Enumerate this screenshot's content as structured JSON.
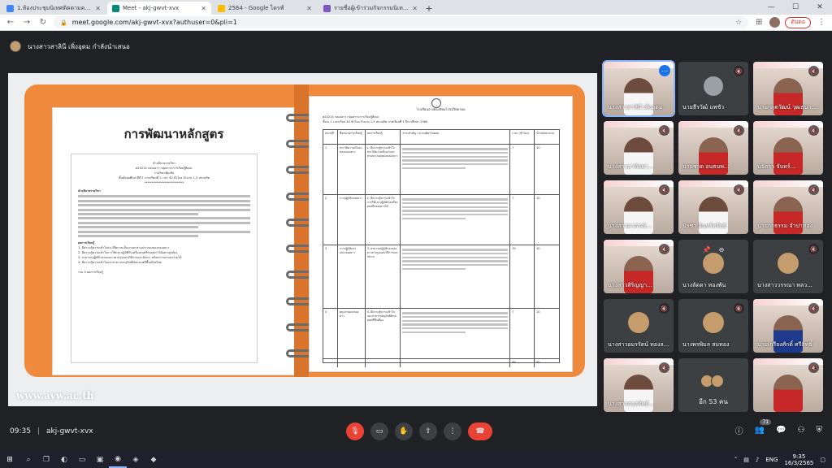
{
  "browser": {
    "tabs": [
      {
        "title": "1.ห้องประชุมนิเทศติดตามครูออนไลน์ (กลุ่มสาระ...",
        "color": "#4285f4",
        "active": false
      },
      {
        "title": "Meet - akj-gwvt-xvx",
        "color": "#00897b",
        "active": true
      },
      {
        "title": "2564 - Google ไดรฟ์",
        "color": "#fbbc04",
        "active": false
      },
      {
        "title": "รายชื่อผู้เข้าร่วมกิจกรรมนิเทศติดตามการจัดการเรียนรู้...",
        "color": "#7e57c2",
        "active": false
      }
    ],
    "new_tab": "+",
    "url": "meet.google.com/akj-gwvt-xvx?authuser=0&pli=1",
    "pause_label": "ดับตอ",
    "window_controls": {
      "minimize": "—",
      "maximize": "☐",
      "close": "✕"
    }
  },
  "meet": {
    "presenter_label": "นางสาวสาลินี เพิ่งอุดม กำลังนำเสนอ",
    "slide": {
      "title": "การพัฒนาหลักสูตร",
      "watermark": "www.ayw.ac.th",
      "left_doc": {
        "heading": "คำอธิบายรายวิชา",
        "code_line": "ศ20214  กลองยาว                    กลุ่มสาระการเรียนรู้ศิลปะ",
        "type_line": "รายวิชาเพิ่มเติม",
        "level_line": "ชั้นมัธยมศึกษาปีที่ 1  ภาคเรียนที่ 1   เวลา 40 ชั่วโมง   จำนวน 1.5 หน่วยกิต",
        "stars": "***************************",
        "section1": "คำอธิบายรายวิชา",
        "section2": "ผลการเรียนรู้",
        "outcomes": [
          "1. มีความรู้ความเข้าใจประวัติความเป็นมาและส่วนประกอบของกลองยาว",
          "2. มีความรู้ความเข้าใจการใช้และปฏิบัติกับเครื่องดนตรีกลองยาวได้อย่างถูกต้อง",
          "3. สามารถปฏิบัติวงกลองยาวตามรูปแบบวิธีการและจังหวะ พร้อมการบรรเลงร่วมได้",
          "4. มีความรู้ความเข้าใจและสามารถอนุรักษ์ศิลปะดนตรีพื้นเมืองไทย"
        ],
        "total": "รวม 4 ผลการเรียนรู้"
      },
      "right_doc": {
        "school": "โรงเรียนอ่างทองปัทมโรจน์วิทยาคม",
        "meta1": "ศ20214  กลองยาว                                   กลุ่มสาระการเรียนรู้ศิลปะ",
        "meta2": "ชั้น ม.1   เวลาเรียน 40 ชั่วโมง   จำนวน 1.5 หน่วยกิต                ภาคเรียนที่ 1  ปีการศึกษา 2564",
        "headers": [
          "หน่วยที่",
          "ชื่อหน่วยการเรียนรู้",
          "ผลการเรียนรู้",
          "สาระสำคัญ / ความคิดรวบยอด",
          "เวลา (ชั่วโมง)",
          "น้ำหนักคะแนน"
        ],
        "rows": [
          {
            "no": "1",
            "unit": "ประวัติความเป็นมาของกลองยาว",
            "outcome": "1. มีความรู้ความเข้าใจประวัติความเป็นมาและส่วนประกอบของกลองยาว",
            "hours": "7",
            "score": "10"
          },
          {
            "no": "2",
            "unit": "การปฏิบัติกลองยาว",
            "outcome": "2. มีความรู้ความเข้าใจการใช้และปฏิบัติกับเครื่องดนตรีกลองยาวได้",
            "hours": "7",
            "score": "10"
          },
          {
            "no": "3",
            "unit": "การปฏิบัติการเล่นกลองยาว",
            "outcome": "3. สามารถปฏิบัติวงกลองยาวตามรูปแบบวิธีการและจังหวะ",
            "hours": "30",
            "score": "30"
          },
          {
            "no": "4",
            "unit": "คุณค่าของกลองยาว",
            "outcome": "4. มีความรู้ความเข้าใจและสามารถอนุรักษ์ศิลปะดนตรีพื้นเมือง",
            "hours": "7",
            "score": "10"
          }
        ],
        "totals": {
          "hours": "84",
          "score": "60"
        }
      }
    },
    "participants": [
      {
        "name": "นางสาวสาลินี เพิ่งอุดม",
        "style": "photo",
        "person": "white",
        "icon": "more",
        "speaking": true
      },
      {
        "name": "นายธีรวัฒ์ แพชัว",
        "style": "dark",
        "person": "none",
        "icon": "mic-off",
        "avatar": true
      },
      {
        "name": "นายกฤตวัฒน์ วุฒธนา...",
        "style": "photo",
        "person": "red",
        "icon": "mic-off"
      },
      {
        "name": "นางสาวอาทิตยา...",
        "style": "photo",
        "person": "white",
        "icon": "mic-off"
      },
      {
        "name": "นายชาด อนธนพ...",
        "style": "photo",
        "person": "red",
        "icon": "mic-off"
      },
      {
        "name": "นิจิตรา จันทร์...",
        "style": "photo",
        "person": "red",
        "icon": "mic-off"
      },
      {
        "name": "นางสาวอาภรณ์...",
        "style": "photo",
        "person": "white",
        "icon": "mic-off"
      },
      {
        "name": "นิรชา อินทร์ทรัพย์",
        "style": "photo",
        "person": "white",
        "icon": "mic-off"
      },
      {
        "name": "นายกรธรรม จำปาทอง",
        "style": "photo",
        "person": "red",
        "icon": "mic-off"
      },
      {
        "name": "นางสาวสิริญญา...",
        "style": "photo",
        "person": "red",
        "icon": "mic-off"
      },
      {
        "name": "นางลัดดา ทองพัน",
        "style": "dark",
        "person": "none",
        "icon": "pin",
        "avatar_photo": true
      },
      {
        "name": "นางสาววรรณา พลว...",
        "style": "dark",
        "person": "none",
        "icon": "mic-off",
        "avatar_photo": true
      },
      {
        "name": "นางสาวอมรรัตน์ ทองล...",
        "style": "dark",
        "person": "none",
        "icon": "mic-off",
        "avatar_photo": true
      },
      {
        "name": "นางพรพิมล สมทอง",
        "style": "dark",
        "person": "none",
        "icon": "mic-off",
        "avatar_photo": true
      },
      {
        "name": "นายเกรียงศักดิ์ ศรีสิทธิ์",
        "style": "photo",
        "person": "blue",
        "icon": "mic-off"
      },
      {
        "name": "นางสาวสกุลทิพย์...",
        "style": "photo",
        "person": "white",
        "icon": "mic-off"
      },
      {
        "name": "อีก 53 คน",
        "style": "more",
        "person": "none",
        "icon": "none"
      },
      {
        "name": "",
        "style": "photo",
        "person": "red",
        "icon": "mic-off"
      }
    ],
    "controls": {
      "time": "09:35",
      "separator": "|",
      "meeting_code": "akj-gwvt-xvx",
      "participants_count": "71"
    }
  },
  "taskbar": {
    "lang": "ENG",
    "time": "9:35",
    "date": "16/3/2565"
  },
  "colors": {
    "meet_bg": "#202124",
    "tile_bg": "#3c4043",
    "notebook_orange": "#ef8a3c",
    "end_call_red": "#ea4335",
    "speaking_outline": "#8ab4f8"
  }
}
